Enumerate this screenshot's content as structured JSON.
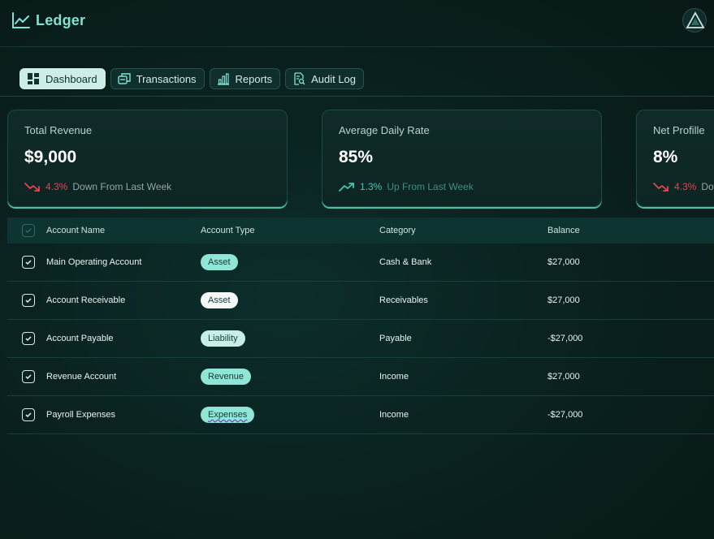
{
  "app": {
    "name": "Ledger",
    "brand_icon": "trend-line-icon",
    "accent": "#7fe3d3"
  },
  "tabs": [
    {
      "label": "Dashboard",
      "icon": "grid-icon",
      "active": true
    },
    {
      "label": "Transactions",
      "icon": "transactions-icon",
      "active": false
    },
    {
      "label": "Reports",
      "icon": "bar-chart-icon",
      "active": false
    },
    {
      "label": "Audit Log",
      "icon": "document-search-icon",
      "active": false
    }
  ],
  "cards": [
    {
      "label": "Total Revenue",
      "value": "$9,000",
      "pct": "4.3%",
      "text": "Down From Last Week",
      "direction": "down"
    },
    {
      "label": "Average Daily Rate",
      "value": "85%",
      "pct": "1.3%",
      "text": "Up From Last Week",
      "direction": "up"
    },
    {
      "label": "Net Profille",
      "value": "8%",
      "pct": "4.3%",
      "text": "Down From Last Week",
      "direction": "down"
    }
  ],
  "table": {
    "headers": [
      "Account Name",
      "Account Type",
      "Category",
      "Balance"
    ],
    "rows": [
      {
        "name": "Main Operating Account",
        "type": "Asset",
        "category": "Cash & Bank",
        "balance": "$27,000"
      },
      {
        "name": "Account Receivable",
        "type": "Asset",
        "category": "Receivables",
        "balance": "$27,000"
      },
      {
        "name": "Account Payable",
        "type": "Liability",
        "category": "Payable",
        "balance": "-$27,000"
      },
      {
        "name": "Revenue Account",
        "type": "Revenue",
        "category": "Income",
        "balance": "$27,000"
      },
      {
        "name": "Payroll Expenses",
        "type": "Expenses",
        "category": "Income",
        "balance": "-$27,000"
      }
    ]
  },
  "colors": {
    "down": "#e9434f",
    "up": "#3fc7b2",
    "background": "#0a2220"
  }
}
